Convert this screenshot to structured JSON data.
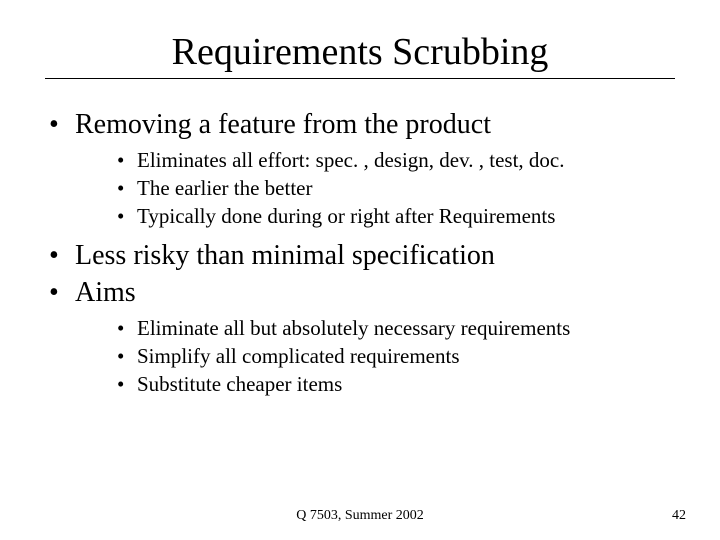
{
  "title": "Requirements Scrubbing",
  "bullets": {
    "l1_0": "Removing a feature from the product",
    "l2_0_0": "Eliminates all effort: spec. , design, dev. , test, doc.",
    "l2_0_1": "The earlier the better",
    "l2_0_2": "Typically done during or right after Requirements",
    "l1_1": "Less risky than minimal specification",
    "l1_2": "Aims",
    "l2_2_0": "Eliminate all but absolutely necessary requirements",
    "l2_2_1": "Simplify all complicated requirements",
    "l2_2_2": "Substitute cheaper items"
  },
  "footer": "Q 7503, Summer 2002",
  "page_number": "42"
}
